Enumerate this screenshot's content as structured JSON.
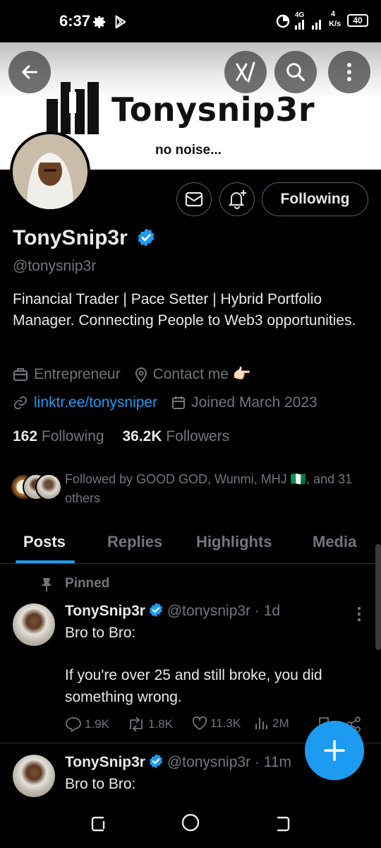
{
  "status_bar": {
    "time": "6:37",
    "network": "4G",
    "speed_top": "4",
    "speed_unit": "K/s",
    "battery": "40",
    "icons": [
      "gear-icon",
      "play-store-icon",
      "data-saver-icon",
      "signal-icon",
      "battery-icon"
    ]
  },
  "header": {
    "banner_title": "Tonysnip3r",
    "banner_subtitle": "no noise...",
    "buttons": [
      "back-icon",
      "grok-icon",
      "search-icon",
      "more-icon"
    ]
  },
  "profile": {
    "name": "TonySnip3r",
    "handle": "@tonysnip3r",
    "bio": "Financial Trader | Pace Setter | Hybrid Portfolio Manager. Connecting People to Web3 opportunities.",
    "occupation": "Entrepreneur",
    "location": "Contact me 👉🏻",
    "website": "linktr.ee/tonysniper",
    "joined": "Joined March 2023",
    "following_count": "162",
    "following_label": "Following",
    "followers_count": "36.2K",
    "followers_label": "Followers",
    "follow_button_label": "Following",
    "followed_by": "Followed by GOOD GOD, Wunmi, MHJ 🇳🇬, and 31 others",
    "accent": "#1d9bf0"
  },
  "tabs": [
    {
      "label": "Posts"
    },
    {
      "label": "Replies"
    },
    {
      "label": "Highlights"
    },
    {
      "label": "Media"
    }
  ],
  "posts": [
    {
      "pinned_label": "Pinned",
      "name": "TonySnip3r",
      "handle": "@tonysnip3r · 1d",
      "line1": "Bro to Bro:",
      "line2": "If you're over 25 and still broke, you did something wrong.",
      "replies": "1.9K",
      "reposts": "1.8K",
      "likes": "11.3K",
      "views": "2M"
    },
    {
      "name": "TonySnip3r",
      "handle": "@tonysnip3r · 11m",
      "line1": "Bro to Bro:"
    }
  ]
}
